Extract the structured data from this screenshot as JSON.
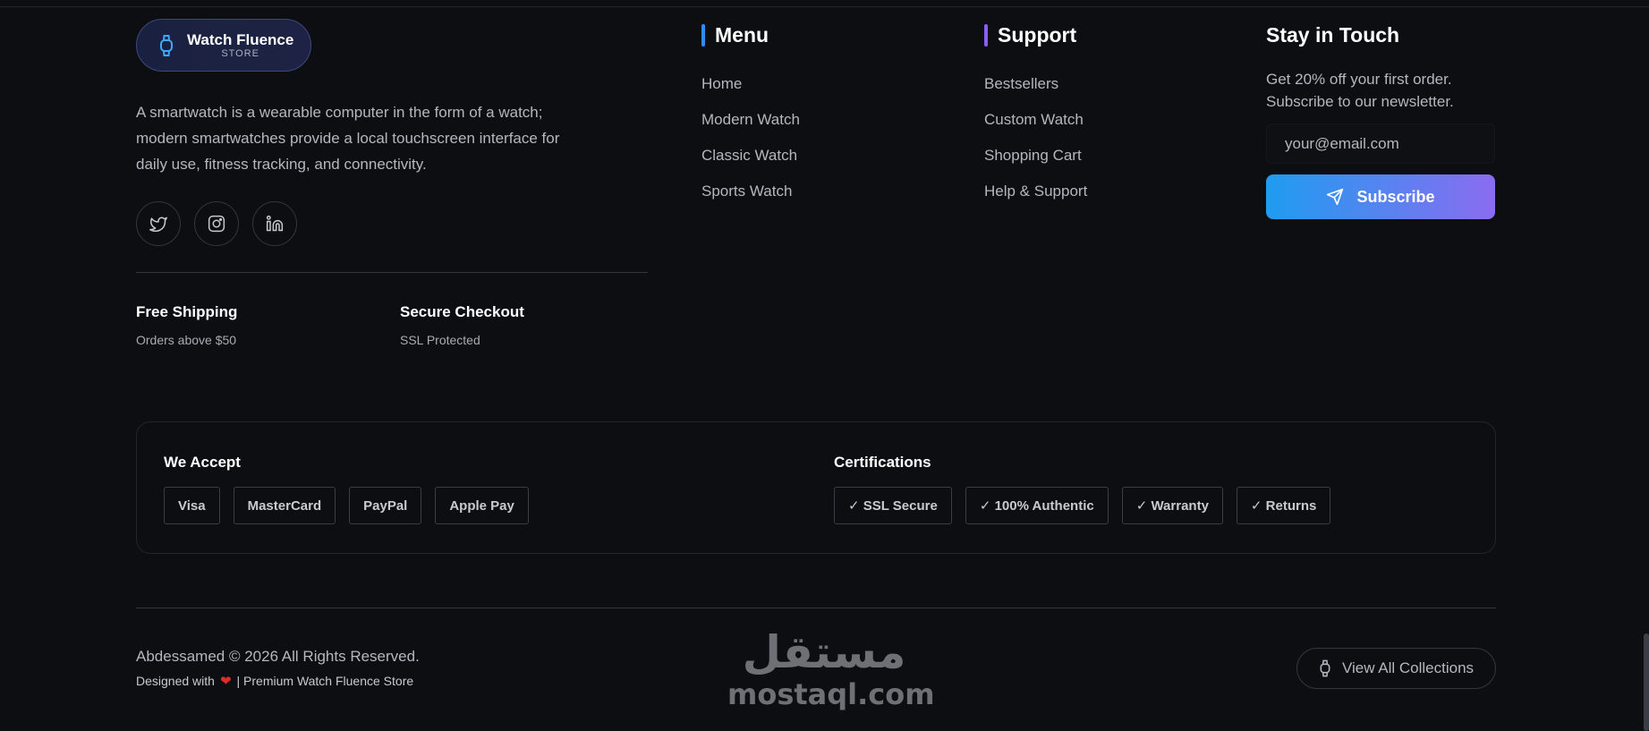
{
  "brand": {
    "name": "Watch Fluence",
    "sub": "STORE"
  },
  "description": "A smartwatch is a wearable computer in the form of a watch; modern smartwatches provide a local touchscreen interface for daily use, fitness tracking, and connectivity.",
  "socials": [
    {
      "icon": "twitter-icon"
    },
    {
      "icon": "instagram-icon"
    },
    {
      "icon": "linkedin-icon"
    }
  ],
  "perks": [
    {
      "title": "Free Shipping",
      "sub": "Orders above $50"
    },
    {
      "title": "Secure Checkout",
      "sub": "SSL Protected"
    }
  ],
  "menu": {
    "title": "Menu",
    "accent": "#2f8cf0",
    "items": [
      "Home",
      "Modern Watch",
      "Classic Watch",
      "Sports Watch"
    ]
  },
  "support": {
    "title": "Support",
    "accent": "#8b5cf6",
    "items": [
      "Bestsellers",
      "Custom Watch",
      "Shopping Cart",
      "Help & Support"
    ]
  },
  "newsletter": {
    "title": "Stay in Touch",
    "promo": "Get 20% off your first order. Subscribe to our newsletter.",
    "placeholder": "your@email.com",
    "button": "Subscribe"
  },
  "payments": {
    "title": "We Accept",
    "items": [
      "Visa",
      "MasterCard",
      "PayPal",
      "Apple Pay"
    ]
  },
  "certifications": {
    "title": "Certifications",
    "items": [
      "✓ SSL Secure",
      "✓ 100% Authentic",
      "✓ Warranty",
      "✓ Returns"
    ]
  },
  "footer": {
    "copyright": "Abdessamed © 2026 All Rights Reserved.",
    "designed_prefix": "Designed with",
    "designed_suffix": "| Premium Watch Fluence Store",
    "view_all": "View All Collections"
  },
  "watermark": {
    "arabic": "مستقل",
    "latin": "mostaql.com"
  }
}
